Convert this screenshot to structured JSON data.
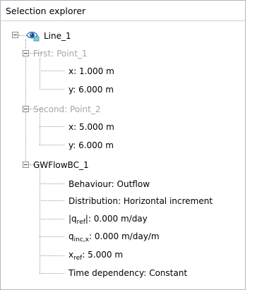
{
  "panel": {
    "title": "Selection explorer"
  },
  "tree": {
    "root": {
      "label": "Line_1",
      "icon": "eye-visibility-icon"
    },
    "first": {
      "label": "First: Point_1",
      "x": "x: 1.000 m",
      "y": "y: 6.000 m"
    },
    "second": {
      "label": "Second: Point_2",
      "x": "x: 5.000 m",
      "y": "y: 6.000 m"
    },
    "gwflow": {
      "label": "GWFlowBC_1",
      "behaviour": "Behaviour: Outflow",
      "distribution": "Distribution: Horizontal increment",
      "qref_prefix": "|q",
      "qref_sub": "ref",
      "qref_suffix": "|: 0.000 m/day",
      "qinc_prefix": "q",
      "qinc_sub": "inc,x",
      "qinc_suffix": ": 0.000 m/day/m",
      "xref_prefix": "x",
      "xref_sub": "ref",
      "xref_suffix": ": 5.000 m",
      "time_dependency": "Time dependency: Constant"
    }
  }
}
